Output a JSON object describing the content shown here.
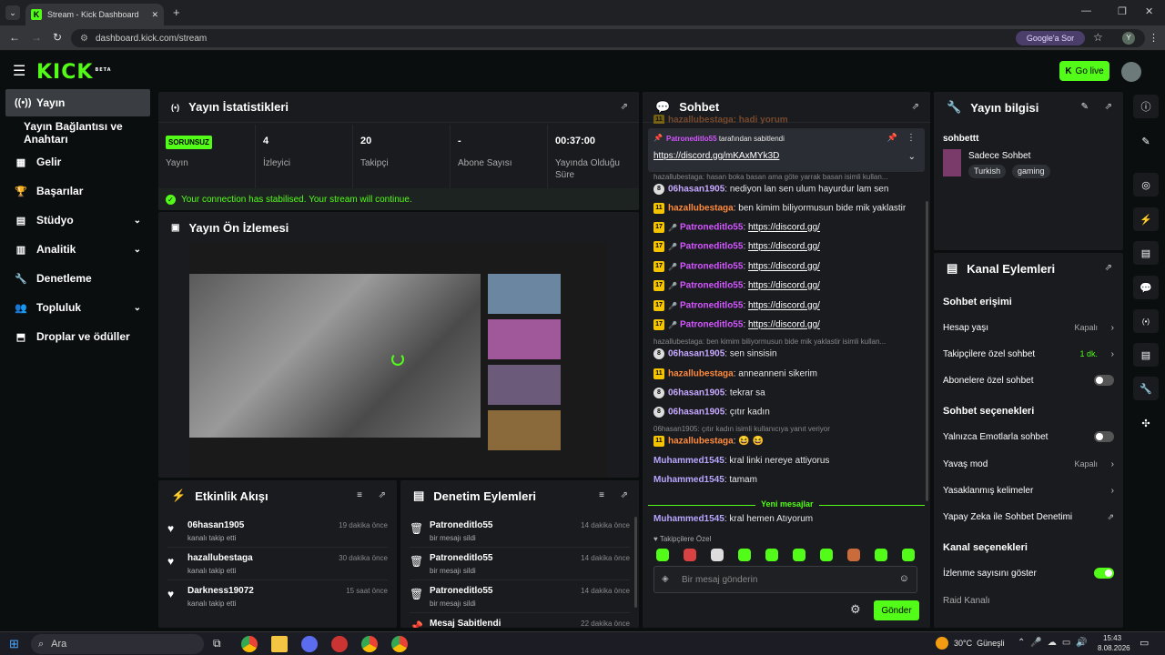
{
  "browser": {
    "tab_title": "Stream - Kick Dashboard",
    "url": "dashboard.kick.com/stream",
    "google_button": "Google'a Sor",
    "profile_letter": "Y"
  },
  "header": {
    "logo": "KICK",
    "logo_sup": "BETA",
    "golive": "Go live"
  },
  "sidebar": {
    "items": [
      {
        "label": "Yayın"
      },
      {
        "label": "Yayın Bağlantısı ve Anahtarı"
      },
      {
        "label": "Gelir"
      },
      {
        "label": "Başarılar"
      },
      {
        "label": "Stüdyo"
      },
      {
        "label": "Analitik"
      },
      {
        "label": "Denetleme"
      },
      {
        "label": "Topluluk"
      },
      {
        "label": "Droplar ve ödüller"
      }
    ]
  },
  "stats": {
    "title": "Yayın İstatistikleri",
    "badge": "SORUNSUZ",
    "items": [
      {
        "value": "",
        "label": "Yayın"
      },
      {
        "value": "4",
        "label": "İzleyici"
      },
      {
        "value": "20",
        "label": "Takipçi"
      },
      {
        "value": "-",
        "label": "Abone Sayısı"
      },
      {
        "value": "00:37:00",
        "label": "Yayında Olduğu Süre"
      }
    ],
    "notice": "Your connection has stabilised. Your stream will continue."
  },
  "preview": {
    "title": "Yayın Ön İzlemesi"
  },
  "activity": {
    "title": "Etkinlik Akışı",
    "rows": [
      {
        "name": "06hasan1905",
        "sub": "kanalı takip etti",
        "time": "19 dakika önce"
      },
      {
        "name": "hazallubestaga",
        "sub": "kanalı takip etti",
        "time": "30 dakika önce"
      },
      {
        "name": "Darkness19072",
        "sub": "kanalı takip etti",
        "time": "15 saat önce"
      }
    ]
  },
  "moderation": {
    "title": "Denetim Eylemleri",
    "rows": [
      {
        "name": "Patroneditlo55",
        "sub": "bir mesajı sildi",
        "time": "14 dakika önce"
      },
      {
        "name": "Patroneditlo55",
        "sub": "bir mesajı sildi",
        "time": "14 dakika önce"
      },
      {
        "name": "Patroneditlo55",
        "sub": "bir mesajı sildi",
        "time": "14 dakika önce"
      },
      {
        "name": "Mesaj Sabitlendi",
        "sub": "",
        "time": "22 dakika önce"
      }
    ]
  },
  "chat": {
    "title": "Sohbet",
    "pinned_by_user": "Patroneditlo55",
    "pinned_by_suffix": "tarafından sabitlendi",
    "pinned_link": "https://discord.gg/mKAxMYk3D",
    "top_cut": "hazallubestaga: hadi yorum",
    "reply1": "hazallubestaga: hasan boka basan ama göte yarrak basan isimli kullan...",
    "reply2": "hazallubestaga: ben kimim biliyormusun bide mik yaklastir isimli kullan...",
    "reply3": "06hasan1905: çıtır kadın isimli kullanıcıya yanıt veriyor",
    "messages": [
      {
        "badge": "8",
        "user": "06hasan1905",
        "text": "nediyon lan sen ulum hayurdur lam sen"
      },
      {
        "badge": "11",
        "user": "hazallubestaga",
        "text": "ben kimim biliyormusun bide mik yaklastir"
      },
      {
        "badge": "17",
        "user": "Patroneditlo55",
        "text": "https://discord.gg/"
      },
      {
        "badge": "17",
        "user": "Patroneditlo55",
        "text": "https://discord.gg/"
      },
      {
        "badge": "17",
        "user": "Patroneditlo55",
        "text": "https://discord.gg/"
      },
      {
        "badge": "17",
        "user": "Patroneditlo55",
        "text": "https://discord.gg/"
      },
      {
        "badge": "17",
        "user": "Patroneditlo55",
        "text": "https://discord.gg/"
      },
      {
        "badge": "17",
        "user": "Patroneditlo55",
        "text": "https://discord.gg/"
      },
      {
        "badge": "8",
        "user": "06hasan1905",
        "text": "sen sinsisin"
      },
      {
        "badge": "11",
        "user": "hazallubestaga",
        "text": "anneanneni sikerim"
      },
      {
        "badge": "8",
        "user": "06hasan1905",
        "text": "tekrar sa"
      },
      {
        "badge": "8",
        "user": "06hasan1905",
        "text": "çıtır kadın"
      },
      {
        "badge": "11",
        "user": "hazallubestaga",
        "text": "😆 😆"
      },
      {
        "badge": "",
        "user": "Muhammed1545",
        "text": "kral linki nereye attiyorus"
      },
      {
        "badge": "",
        "user": "Muhammed1545",
        "text": "tamam"
      },
      {
        "badge": "",
        "user": "Muhammed1545",
        "text": "kral hemen Atıyorum"
      }
    ],
    "new_messages": "Yeni mesajlar",
    "followers_only": "Takipçilere Özel",
    "input_placeholder": "Bir mesaj gönderin",
    "send": "Gönder"
  },
  "info": {
    "title": "Yayın bilgisi",
    "stream_title": "sohbettt",
    "category": "Sadece Sohbet",
    "tags": [
      "Turkish",
      "gaming"
    ]
  },
  "channel": {
    "title": "Kanal Eylemleri",
    "sec1": "Sohbet erişimi",
    "account_age": "Hesap yaşı",
    "account_age_val": "Kapalı",
    "followers_chat": "Takipçilere özel sohbet",
    "followers_chat_val": "1 dk.",
    "subs_chat": "Abonelere özel sohbet",
    "sec2": "Sohbet seçenekleri",
    "emote_only": "Yalnızca Emotlarla sohbet",
    "slow_mode": "Yavaş mod",
    "slow_mode_val": "Kapalı",
    "banned_words": "Yasaklanmış kelimeler",
    "ai_mod": "Yapay Zeka ile Sohbet Denetimi",
    "sec3": "Kanal seçenekleri",
    "show_views": "İzlenme sayısını göster",
    "raid": "Raid Kanalı"
  },
  "taskbar": {
    "search": "Ara",
    "weather": "30°C  Güneşli",
    "time": "15:43",
    "date": "8.08.2026"
  }
}
